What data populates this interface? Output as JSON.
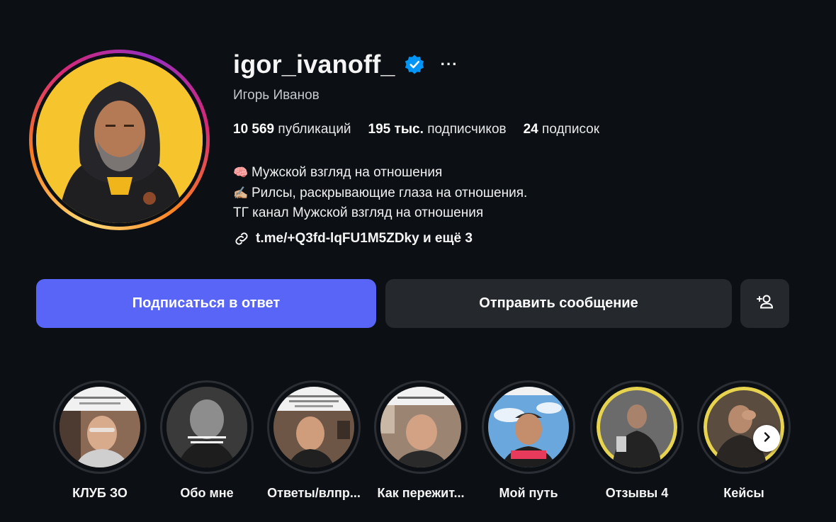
{
  "profile": {
    "username": "igor_ivanoff_",
    "more_label": "···",
    "full_name": "Игорь Иванов",
    "stats": {
      "posts_count": "10 569",
      "posts_label": "публикаций",
      "followers_count": "195 тыс.",
      "followers_label": "подписчиков",
      "following_count": "24",
      "following_label": "подписок"
    },
    "bio": {
      "line1_emoji": "🧠",
      "line1": "Мужской взгляд на отношения",
      "line2_emoji": "✍🏼",
      "line2": "Рилсы, раскрывающие глаза на отношения.",
      "line3": "ТГ канал Мужской взгляд на отношения"
    },
    "link": "t.me/+Q3fd-lqFU1M5ZDky и ещё 3"
  },
  "actions": {
    "follow_back": "Подписаться в ответ",
    "send_message": "Отправить сообщение"
  },
  "highlights": [
    {
      "label": "КЛУБ ЗО"
    },
    {
      "label": "Обо мне"
    },
    {
      "label": "Ответы/влпр..."
    },
    {
      "label": "Как пережит..."
    },
    {
      "label": "Мой путь"
    },
    {
      "label": "Отзывы 4"
    },
    {
      "label": "Кейсы"
    }
  ],
  "colors": {
    "background": "#0c1014",
    "primary_button": "#5865f7",
    "secondary_button": "#25292e",
    "verified_badge": "#0095f6"
  },
  "icons": {
    "verified": "verified-badge-icon",
    "link": "link-icon",
    "add_person": "add-person-icon",
    "next": "chevron-right-icon"
  }
}
